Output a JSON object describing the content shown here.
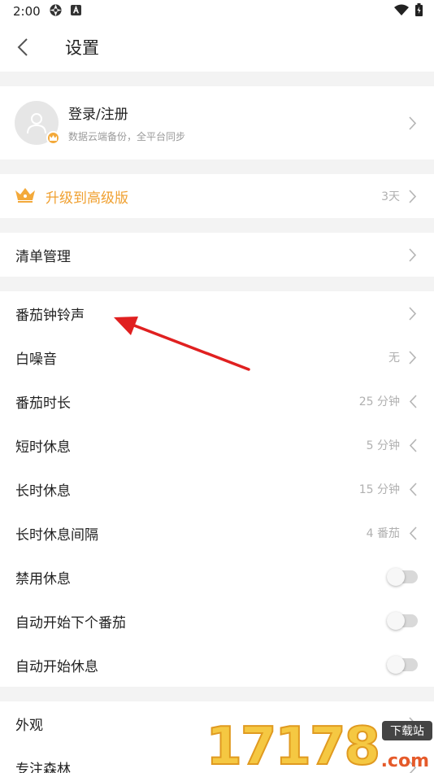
{
  "status_bar": {
    "time": "2:00",
    "icons": [
      "camera-shutter-icon",
      "a-square-icon",
      "wifi-icon",
      "battery-icon"
    ]
  },
  "header": {
    "title": "设置"
  },
  "account": {
    "title": "登录/注册",
    "subtitle": "数据云端备份，全平台同步"
  },
  "upgrade": {
    "label": "升级到高级版",
    "value": "3天",
    "accent": "#f0a030"
  },
  "list_manage": {
    "label": "清单管理"
  },
  "pomodoro_settings": [
    {
      "key": "ringtone",
      "label": "番茄钟铃声",
      "value": "",
      "control": "chevron-right"
    },
    {
      "key": "white-noise",
      "label": "白噪音",
      "value": "无",
      "control": "chevron-right"
    },
    {
      "key": "pomodoro-length",
      "label": "番茄时长",
      "value": "25 分钟",
      "control": "chevron-left"
    },
    {
      "key": "short-break",
      "label": "短时休息",
      "value": "5 分钟",
      "control": "chevron-left"
    },
    {
      "key": "long-break",
      "label": "长时休息",
      "value": "15 分钟",
      "control": "chevron-left"
    },
    {
      "key": "long-break-interval",
      "label": "长时休息间隔",
      "value": "4 番茄",
      "control": "chevron-left"
    },
    {
      "key": "disable-break",
      "label": "禁用休息",
      "value": "",
      "control": "toggle",
      "on": false
    },
    {
      "key": "auto-next-pomodoro",
      "label": "自动开始下个番茄",
      "value": "",
      "control": "toggle",
      "on": false
    },
    {
      "key": "auto-start-break",
      "label": "自动开始休息",
      "value": "",
      "control": "toggle",
      "on": false
    }
  ],
  "other_settings": [
    {
      "key": "appearance",
      "label": "外观"
    },
    {
      "key": "focus-forest",
      "label": "专注森林"
    }
  ],
  "watermark": {
    "digits": "17178",
    "badge": "下载站",
    "suffix": ".com"
  },
  "colors": {
    "annotation_arrow": "#e02020",
    "crown": "#f3a93a"
  }
}
